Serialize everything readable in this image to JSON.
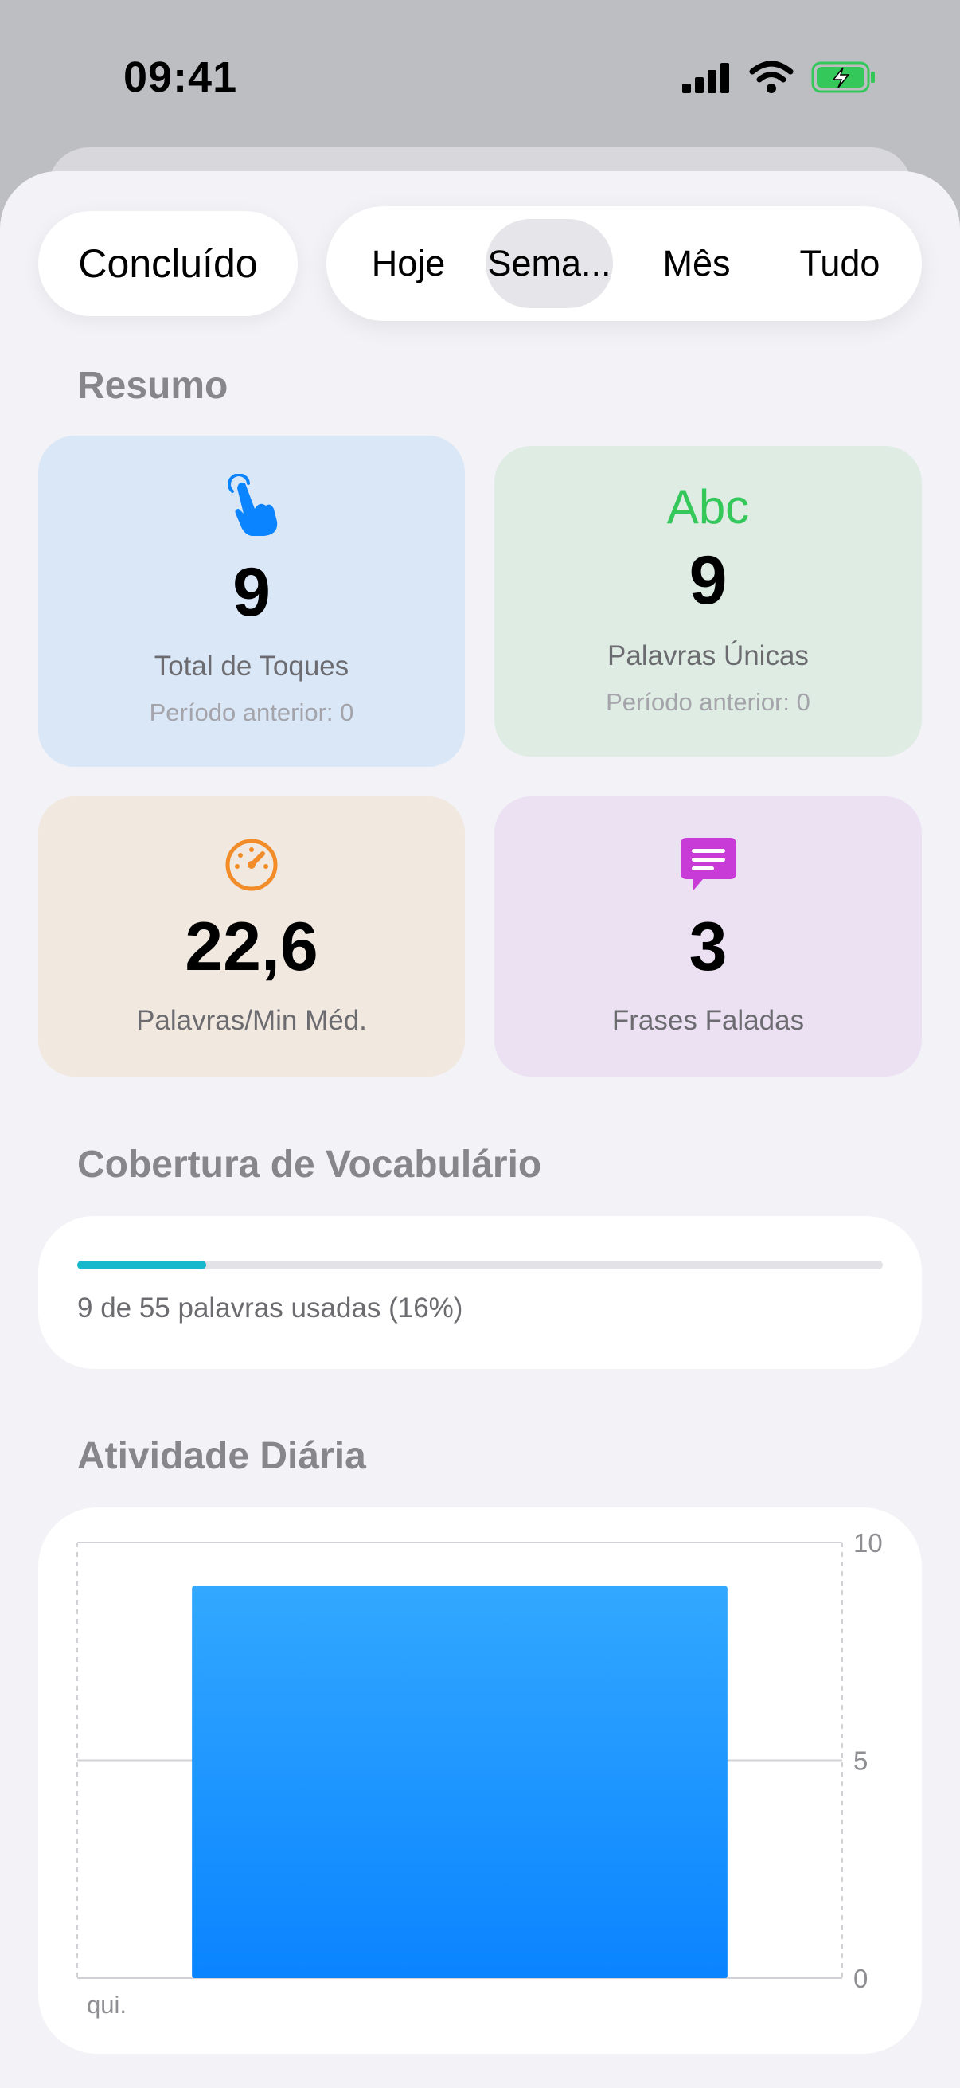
{
  "status_bar": {
    "time": "09:41"
  },
  "toolbar": {
    "done_label": "Concluído",
    "segments": [
      "Hoje",
      "Sema...",
      "Mês",
      "Tudo"
    ],
    "selected_segment": "Sema..."
  },
  "summary": {
    "title": "Resumo",
    "cards": [
      {
        "icon": "hand-tap-icon",
        "value": "9",
        "label": "Total de Toques",
        "sub": "Período anterior: 0",
        "color": "#0a84ff"
      },
      {
        "icon": "abc-icon",
        "icon_text": "Abc",
        "value": "9",
        "label": "Palavras Únicas",
        "sub": "Período anterior: 0",
        "color": "#34c759"
      },
      {
        "icon": "speedometer-icon",
        "value": "22,6",
        "label": "Palavras/Min Méd.",
        "color": "#f28c28"
      },
      {
        "icon": "speech-bubble-icon",
        "value": "3",
        "label": "Frases Faladas",
        "color": "#c93bd6"
      }
    ]
  },
  "vocabulary": {
    "title": "Cobertura de Vocabulário",
    "used": 9,
    "total": 55,
    "progress": 0.16,
    "text": "9 de 55 palavras usadas (16%)",
    "color": "#17b7cc"
  },
  "activity": {
    "title": "Atividade Diária"
  },
  "chart_data": {
    "type": "bar",
    "categories": [
      "qui."
    ],
    "values": [
      9
    ],
    "title": "",
    "xlabel": "",
    "ylabel": "",
    "ylim": [
      0,
      10
    ],
    "yticks": [
      "0",
      "5",
      "10"
    ],
    "grid": true,
    "color": "#0a84ff"
  }
}
